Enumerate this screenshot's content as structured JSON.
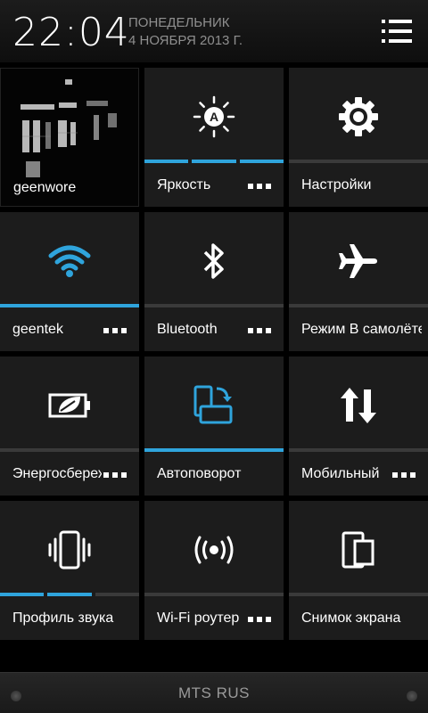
{
  "status": {
    "time": "22:04",
    "day": "ПОНЕДЕЛЬНИК",
    "date": "4 НОЯБРЯ 2013 Г."
  },
  "tiles": [
    {
      "label": "geenwore",
      "icon": "photo-thumbnail"
    },
    {
      "label": "Яркость",
      "icon": "brightness-auto-icon"
    },
    {
      "label": "Настройки",
      "icon": "gear-icon"
    },
    {
      "label": "geentek",
      "icon": "wifi-icon"
    },
    {
      "label": "Bluetooth",
      "icon": "bluetooth-icon"
    },
    {
      "label": "Режим В самолёте",
      "icon": "airplane-icon"
    },
    {
      "label": "Энергосбережение",
      "icon": "battery-leaf-icon"
    },
    {
      "label": "Автоповорот",
      "icon": "auto-rotate-icon"
    },
    {
      "label": "Мобильный",
      "icon": "mobile-data-icon"
    },
    {
      "label": "Профиль звука",
      "icon": "vibrate-icon"
    },
    {
      "label": "Wi-Fi роутер",
      "icon": "hotspot-icon"
    },
    {
      "label": "Снимок экрана",
      "icon": "screenshot-icon"
    }
  ],
  "footer": {
    "carrier": "MTS RUS"
  },
  "colors": {
    "accent": "#2fa4dc",
    "tile_bg": "#1c1c1c",
    "inactive_bar": "#3a3a3a"
  }
}
